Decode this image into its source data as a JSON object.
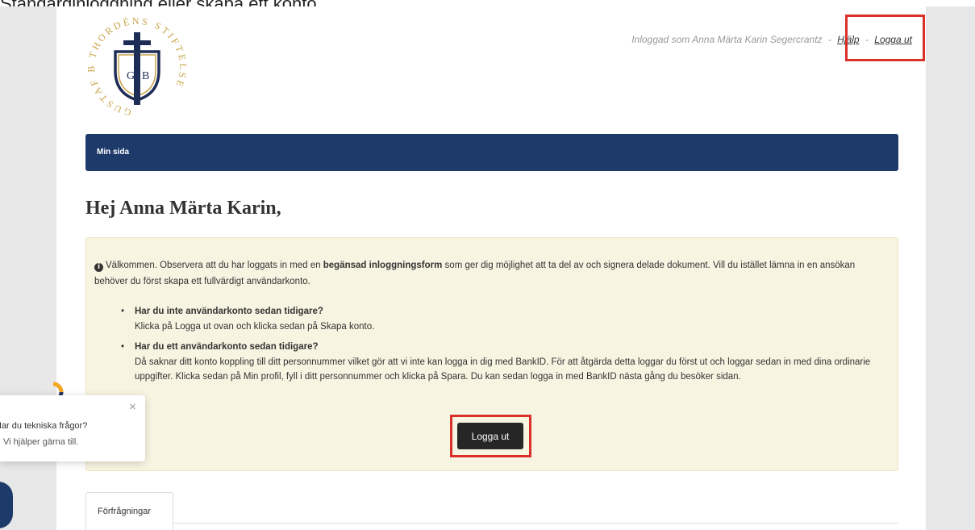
{
  "caption": "Standardinloggning eller skapa ett konto.",
  "logo": {
    "ring_text": "GUSTAF B THORDÉNS STIFTELSE",
    "monogram_left": "G",
    "monogram_right": "B"
  },
  "header": {
    "logged_in_text": "Inloggad som Anna Märta Karin Segercrantz",
    "separator": "-",
    "help_link": "Hjälp",
    "logout_link": "Logga ut"
  },
  "nav": {
    "items": [
      "Min sida"
    ]
  },
  "greeting": "Hej Anna Märta Karin,",
  "alert": {
    "intro_before": "Välkommen. Observera att du har loggats in med en ",
    "intro_bold": "begänsad inloggningsform",
    "intro_after": " som ger dig möjlighet att ta del av och signera delade dokument. Vill du istället lämna in en ansökan behöver du först skapa ett fullvärdigt användarkonto.",
    "items": [
      {
        "question": "Har du inte användarkonto sedan tidigare?",
        "answer": "Klicka på Logga ut ovan och klicka sedan på Skapa konto."
      },
      {
        "question": "Har du ett användarkonto sedan tidigare?",
        "answer": "Då saknar ditt konto koppling till ditt personnummer vilket gör att vi inte kan logga in dig med BankID. För att åtgärda detta loggar du först ut och loggar sedan in med dina ordinarie uppgifter. Klicka sedan på Min profil, fyll i ditt personnummer och klicka på Spara. Du kan sedan logga in med BankID nästa gång du besöker sidan."
      }
    ],
    "button_label": "Logga ut"
  },
  "tabs": [
    "Förfrågningar"
  ],
  "chat": {
    "line1": "Har du tekniska frågor?",
    "line2": "Vi hjälper gärna till.",
    "close": "×"
  },
  "colors": {
    "navbar": "#1e3a6b",
    "alert_bg": "#f8f4e2",
    "highlight": "#d9302a",
    "logo_gold": "#c9a44a",
    "logo_navy": "#1e2d55"
  }
}
